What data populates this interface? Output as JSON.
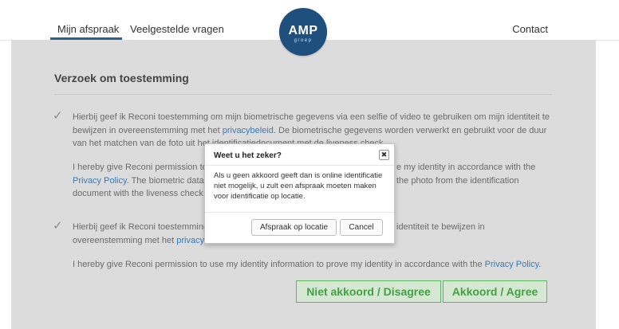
{
  "header": {
    "nav": [
      "Mijn afspraak",
      "Veelgestelde vragen"
    ],
    "contact": "Contact",
    "logo_text": "AMP",
    "logo_sub": "groep"
  },
  "card": {
    "title": "Verzoek om toestemming",
    "section1": {
      "nl_line1": "Hierbij geef ik Reconi toestemming om mijn biometrische gegevens via een selfie of video te gebruiken om mijn identiteit te",
      "nl_line2_pre": "bewijzen in overeenstemming met het ",
      "nl_link": "privacybeleid",
      "nl_line2_post": ". De biometrische gegevens worden verwerkt en gebruikt voor de duur",
      "nl_line3": "van het matchen van de foto uit het identificatiedocument met de liveness check.",
      "en_line1_left": "I hereby give Reconi permission to",
      "en_line1_right": "e my identity in accordance with the",
      "en_line2_link": "Privacy Policy",
      "en_line2_left": ". The biometric data i",
      "en_line2_right": "the photo from the identification",
      "en_line3": "document with the liveness check."
    },
    "section2": {
      "nl_line1_left": "Hierbij geef ik Reconi toestemming",
      "nl_line1_right": "identiteit te bewijzen in",
      "nl_line2_pre": "overeenstemming met het ",
      "nl_link": "privacyb",
      "en_pre": "I hereby give Reconi permission to use my identity information to prove my identity in accordance with the ",
      "en_link": "Privacy Policy",
      "en_post": "."
    },
    "buttons": {
      "disagree": "Niet akkoord / Disagree",
      "agree": "Akkoord / Agree"
    }
  },
  "modal": {
    "title": "Weet u het zeker?",
    "close": "✖",
    "body": "Als u geen akkoord geeft dan is online identificatie niet mogelijk, u zult een afspraak moeten maken voor identificatie op locatie.",
    "btn_location": "Afspraak op locatie",
    "btn_cancel": "Cancel"
  },
  "colors": {
    "brand": "#1f4f7c",
    "accept_green": "#5cb85c",
    "link": "#3a79b5"
  },
  "icons": [
    "check-icon",
    "close-icon"
  ]
}
